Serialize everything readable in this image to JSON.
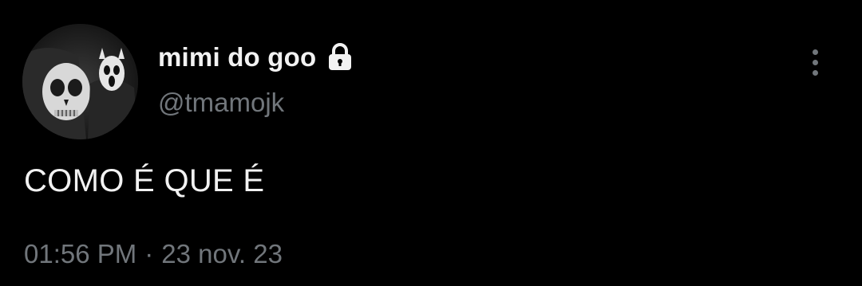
{
  "author": {
    "display_name": "mimi do goo",
    "handle": "@tmamojk",
    "protected_icon": "lock-icon",
    "avatar": "profile-photo"
  },
  "tweet": {
    "text": "COMO É QUE É",
    "time": "01:56 PM",
    "separator": "·",
    "date": "23 nov. 23"
  },
  "actions": {
    "more_icon": "more-vertical-icon"
  },
  "colors": {
    "background": "#000000",
    "primary_text": "#f2f2f2",
    "secondary_text": "#71767b"
  }
}
